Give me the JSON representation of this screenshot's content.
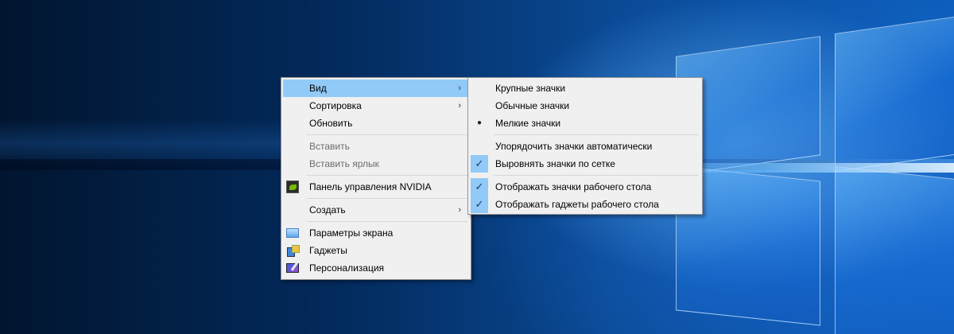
{
  "context_menu": {
    "items": [
      {
        "label": "Вид",
        "has_submenu": true,
        "state": "active"
      },
      {
        "label": "Сортировка",
        "has_submenu": true
      },
      {
        "label": "Обновить"
      },
      {
        "label": "Вставить",
        "state": "disabled"
      },
      {
        "label": "Вставить ярлык",
        "state": "disabled"
      },
      {
        "label": "Панель управления NVIDIA",
        "icon": "nvidia-icon"
      },
      {
        "label": "Создать",
        "has_submenu": true
      },
      {
        "label": "Параметры экрана",
        "icon": "display-icon"
      },
      {
        "label": "Гаджеты",
        "icon": "gadgets-icon"
      },
      {
        "label": "Персонализация",
        "icon": "personalization-icon"
      }
    ]
  },
  "view_submenu": {
    "items": [
      {
        "label": "Крупные значки"
      },
      {
        "label": "Обычные значки"
      },
      {
        "label": "Мелкие значки",
        "mark": "bullet"
      },
      {
        "label": "Упорядочить значки автоматически"
      },
      {
        "label": "Выровнять значки по сетке",
        "mark": "check"
      },
      {
        "label": "Отображать значки рабочего стола",
        "mark": "check"
      },
      {
        "label": "Отображать гаджеты  рабочего стола",
        "mark": "check"
      }
    ]
  },
  "glyphs": {
    "arrow": "›",
    "check": "✓",
    "bullet": "●"
  },
  "colors": {
    "highlight": "#91c9f7",
    "menu_bg": "#f0f0f0",
    "disabled_text": "#6d6d6d"
  }
}
